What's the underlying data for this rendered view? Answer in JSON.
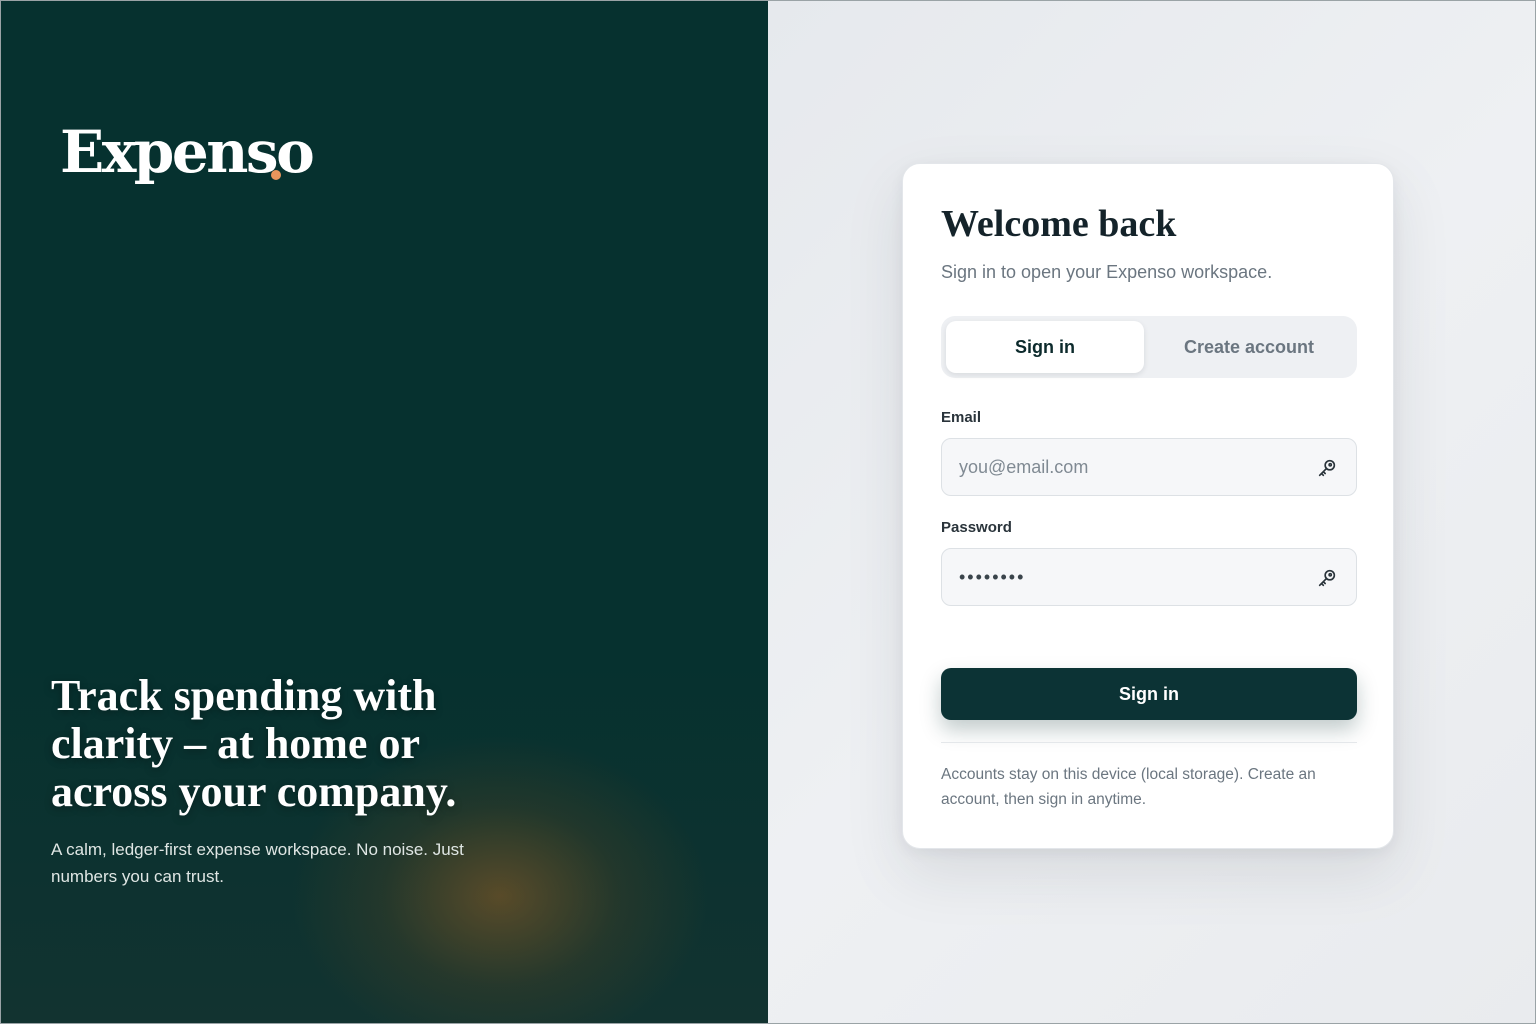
{
  "hero": {
    "brand": "Expenso",
    "headline": "Track spending with clarity – at home or across your company.",
    "subtext": "A calm, ledger-first expense workspace. No noise. Just numbers you can trust."
  },
  "card": {
    "title": "Welcome back",
    "subtitle": "Sign in to open your Expenso workspace.",
    "tabs": [
      {
        "label": "Sign in",
        "active": true
      },
      {
        "label": "Create account",
        "active": false
      }
    ],
    "email": {
      "label": "Email",
      "placeholder": "you@email.com",
      "value": ""
    },
    "password": {
      "label": "Password",
      "value": "••••••••"
    },
    "submit_label": "Sign in",
    "footnote": "Accounts stay on this device (local storage). Create an account, then sign in anytime."
  },
  "colors": {
    "hero_bg": "#06312f",
    "accent_dot": "#e8955c",
    "primary_button": "#0c3335"
  },
  "icons": {
    "email_field_icon": "key-icon",
    "password_field_icon": "key-icon"
  }
}
